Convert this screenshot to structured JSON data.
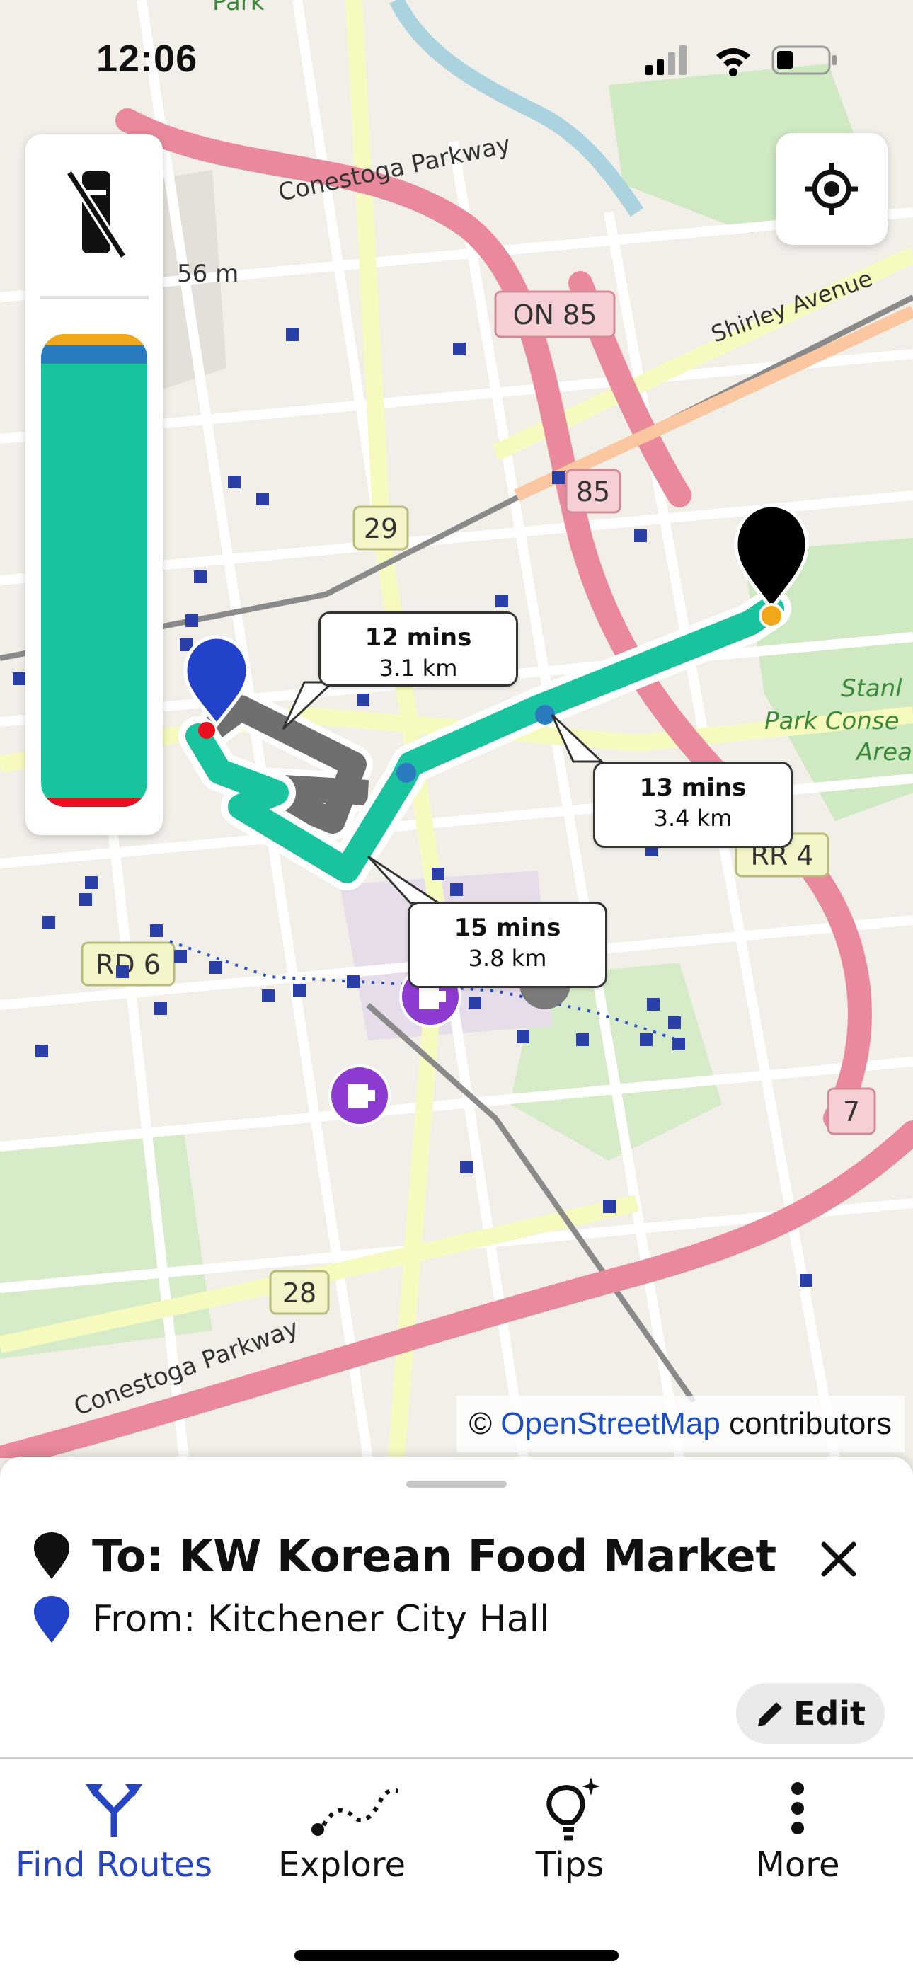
{
  "status_bar": {
    "time": "12:06"
  },
  "map": {
    "labels": {
      "conestoga_top": "Conestoga Parkway",
      "conestoga_bottom": "Conestoga Parkway",
      "shirley": "Shirley Avenue",
      "on85": "ON 85",
      "r85": "85",
      "r29": "29",
      "rr4": "RR 4",
      "rd6": "RD 6",
      "r28": "28",
      "r7": "7",
      "park_top": "Park",
      "elev": "56 m",
      "park1": "Stanl",
      "park2": "Park Conse",
      "park3": "Area"
    },
    "route_bubbles": [
      {
        "time": "12 mins",
        "distance": "3.1 km"
      },
      {
        "time": "13 mins",
        "distance": "3.4 km"
      },
      {
        "time": "15 mins",
        "distance": "3.8 km"
      }
    ],
    "attribution": {
      "prefix": "©",
      "link": "OpenStreetMap",
      "suffix": "contributors"
    }
  },
  "level_panel": {
    "icon": "no-phone-icon",
    "bar_colors": [
      "#f0a71a",
      "#2b7bbf",
      "#19c39d",
      "#e8101e"
    ]
  },
  "route_sheet": {
    "to_label": "To: KW Korean Food Market",
    "from_label": "From: Kitchener City Hall",
    "edit_label": "Edit"
  },
  "tabs": [
    {
      "label": "Find Routes",
      "icon": "fork-arrows-icon",
      "active": true
    },
    {
      "label": "Explore",
      "icon": "dotted-path-icon",
      "active": false
    },
    {
      "label": "Tips",
      "icon": "lightbulb-sparkle-icon",
      "active": false
    },
    {
      "label": "More",
      "icon": "vertical-dots-icon",
      "active": false
    }
  ],
  "colors": {
    "accent": "#2545c4",
    "route_green": "#19c39d",
    "route_gray": "#6f6f6f",
    "road_pink": "#e9899b"
  }
}
